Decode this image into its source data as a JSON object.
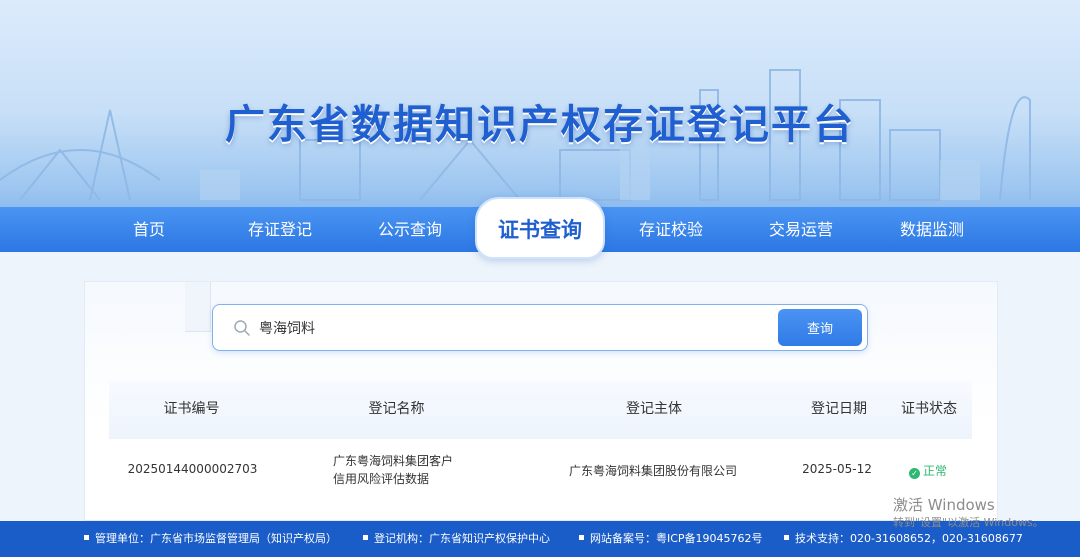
{
  "banner": {
    "title": "广东省数据知识产权存证登记平台"
  },
  "nav": {
    "items": [
      {
        "label": "首页"
      },
      {
        "label": "存证登记"
      },
      {
        "label": "公示查询"
      },
      {
        "label": "证书查询",
        "active": true
      },
      {
        "label": "存证校验"
      },
      {
        "label": "交易运营"
      },
      {
        "label": "数据监测"
      }
    ]
  },
  "search": {
    "value": "粤海饲料",
    "button_label": "查询"
  },
  "table": {
    "headers": [
      "证书编号",
      "登记名称",
      "登记主体",
      "登记日期",
      "证书状态"
    ],
    "rows": [
      {
        "cert_no": "20250144000002703",
        "name_line1": "广东粤海饲料集团客户",
        "name_line2": "信用风险评估数据",
        "subject": "广东粤海饲料集团股份有限公司",
        "date": "2025-05-12",
        "status": "正常"
      }
    ]
  },
  "footer": {
    "items": [
      {
        "text": "管理单位：广东省市场监督管理局（知识产权局）"
      },
      {
        "text": "登记机构：广东省知识产权保护中心"
      },
      {
        "text": "网站备案号：粤ICP备19045762号"
      },
      {
        "text": "技术支持：020-31608652，020-31608677"
      }
    ]
  },
  "watermark": {
    "line1": "激活 Windows",
    "line2": "转到\"设置\"以激活 Windows。"
  },
  "colors": {
    "primary": "#2c77e4",
    "title": "#1f5fcf",
    "footer": "#1a5cc8",
    "status_ok": "#2eb872"
  },
  "icons": {
    "search": "search-icon",
    "status": "check-circle-icon"
  }
}
